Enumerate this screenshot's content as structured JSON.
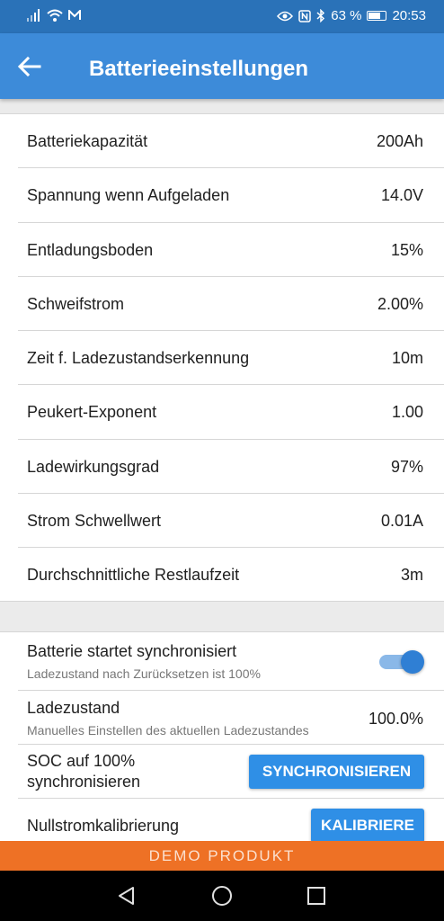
{
  "status_bar": {
    "battery_percent": "63 %",
    "time": "20:53",
    "icons": [
      "signal-icon",
      "wifi-icon",
      "m-notification-icon",
      "eye-icon",
      "nfc-icon",
      "bluetooth-icon",
      "battery-icon"
    ]
  },
  "app_bar": {
    "title": "Batterieeinstellungen",
    "back_icon": "arrow-left-icon"
  },
  "settings": [
    {
      "label": "Batteriekapazität",
      "value": "200Ah"
    },
    {
      "label": "Spannung wenn Aufgeladen",
      "value": "14.0V"
    },
    {
      "label": "Entladungsboden",
      "value": "15%"
    },
    {
      "label": "Schweifstrom",
      "value": "2.00%"
    },
    {
      "label": "Zeit f. Ladezustandserkennung",
      "value": "10m"
    },
    {
      "label": "Peukert-Exponent",
      "value": "1.00"
    },
    {
      "label": "Ladewirkungsgrad",
      "value": "97%"
    },
    {
      "label": "Strom Schwellwert",
      "value": "0.01A"
    },
    {
      "label": "Durchschnittliche Restlaufzeit",
      "value": "3m"
    }
  ],
  "sync_section": {
    "synced_start": {
      "label": "Batterie startet synchronisiert",
      "sub": "Ladezustand nach Zurücksetzen ist 100%",
      "toggle_on": true
    },
    "soc": {
      "label": "Ladezustand",
      "sub": "Manuelles Einstellen des aktuellen Ladezustandes",
      "value": "100.0%"
    },
    "sync": {
      "label_line1": "SOC auf 100%",
      "label_line2": "synchronisieren",
      "button": "SYNCHRONISIEREN"
    },
    "zero_cal": {
      "label": "Nullstromkalibrierung",
      "button": "KALIBRIERE"
    }
  },
  "demo_banner": "DEMO PRODUKT",
  "colors": {
    "status_bar": "#2a72b8",
    "app_bar": "#3d8bd9",
    "button": "#2f8fe6",
    "demo_banner": "#ee7125"
  },
  "nav": [
    "back-triangle-icon",
    "home-circle-icon",
    "recents-square-icon"
  ]
}
